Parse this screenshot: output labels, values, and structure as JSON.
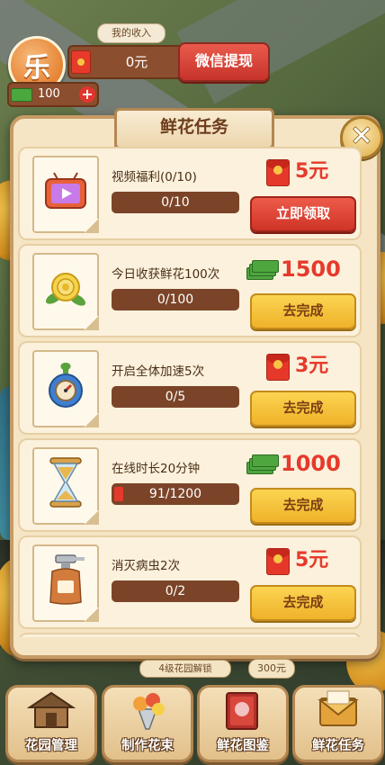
{
  "hud": {
    "avatar_char": "乐",
    "income_label": "我的收入",
    "income_amount": "0元",
    "withdraw_button": "微信提现",
    "cash_amount": "100",
    "add_button": "+"
  },
  "panel": {
    "title": "鲜花任务",
    "close_symbol": "✕",
    "tasks": [
      {
        "name": "视频福利(0/10)",
        "progress_text": "0/10",
        "progress": 0.0,
        "reward_type": "red-packet",
        "reward": "5元",
        "button": "立即领取",
        "button_style": "red",
        "icon": "video-tv-icon"
      },
      {
        "name": "今日收获鲜花100次",
        "progress_text": "0/100",
        "progress": 0.0,
        "reward_type": "cash",
        "reward": "1500",
        "button": "去完成",
        "button_style": "yellow",
        "icon": "yellow-rose-icon"
      },
      {
        "name": "开启全体加速5次",
        "progress_text": "0/5",
        "progress": 0.0,
        "reward_type": "red-packet",
        "reward": "3元",
        "button": "去完成",
        "button_style": "yellow",
        "icon": "speed-potion-icon"
      },
      {
        "name": "在线时长20分钟",
        "progress_text": "91/1200",
        "progress": 0.076,
        "reward_type": "cash",
        "reward": "1000",
        "button": "去完成",
        "button_style": "yellow",
        "icon": "hourglass-icon"
      },
      {
        "name": "消灭病虫2次",
        "progress_text": "0/2",
        "progress": 0.0,
        "reward_type": "red-packet",
        "reward": "5元",
        "button": "去完成",
        "button_style": "yellow",
        "icon": "spray-bottle-icon"
      }
    ]
  },
  "bottom": {
    "unlock_label": "4级花园解锁",
    "price_label": "300元",
    "nav": [
      "花园管理",
      "制作花束",
      "鲜花图鉴",
      "鲜花任务"
    ]
  },
  "colors": {
    "accent_red": "#e63a2c",
    "button_yellow": "#f0b22a",
    "panel_bg": "#f5e5c4",
    "progress_bg": "#7b4428"
  }
}
